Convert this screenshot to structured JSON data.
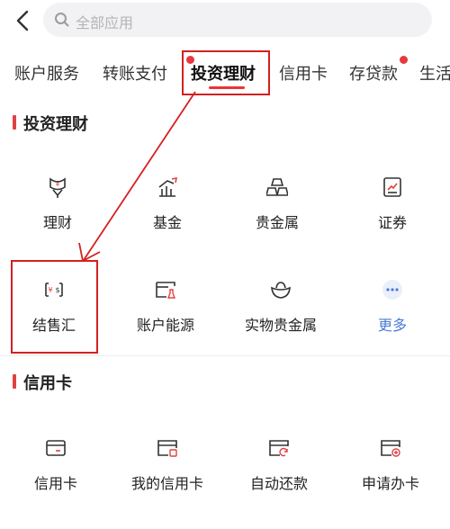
{
  "search": {
    "placeholder": "全部应用"
  },
  "tabs": [
    {
      "label": "账户服务"
    },
    {
      "label": "转账支付"
    },
    {
      "label": "投资理财",
      "active": true
    },
    {
      "label": "信用卡"
    },
    {
      "label": "存贷款",
      "badge": true
    },
    {
      "label": "生活"
    }
  ],
  "sections": [
    {
      "title": "投资理财",
      "items": [
        {
          "label": "理财",
          "icon": "yuan-flower-icon"
        },
        {
          "label": "基金",
          "icon": "chart-growth-icon"
        },
        {
          "label": "贵金属",
          "icon": "gold-bars-icon"
        },
        {
          "label": "证券",
          "icon": "stock-chart-icon"
        },
        {
          "label": "结售汇",
          "icon": "currency-exchange-icon"
        },
        {
          "label": "账户能源",
          "icon": "energy-account-icon"
        },
        {
          "label": "实物贵金属",
          "icon": "ingot-icon"
        },
        {
          "label": "更多",
          "icon": "more-dots-icon"
        }
      ]
    },
    {
      "title": "信用卡",
      "items": [
        {
          "label": "信用卡",
          "icon": "credit-card-icon"
        },
        {
          "label": "我的信用卡",
          "icon": "my-card-icon"
        },
        {
          "label": "自动还款",
          "icon": "auto-repay-icon"
        },
        {
          "label": "申请办卡",
          "icon": "apply-card-icon"
        }
      ]
    }
  ],
  "colors": {
    "accent": "#e8383d",
    "annotation": "#d42020",
    "link": "#4a7bd8"
  }
}
